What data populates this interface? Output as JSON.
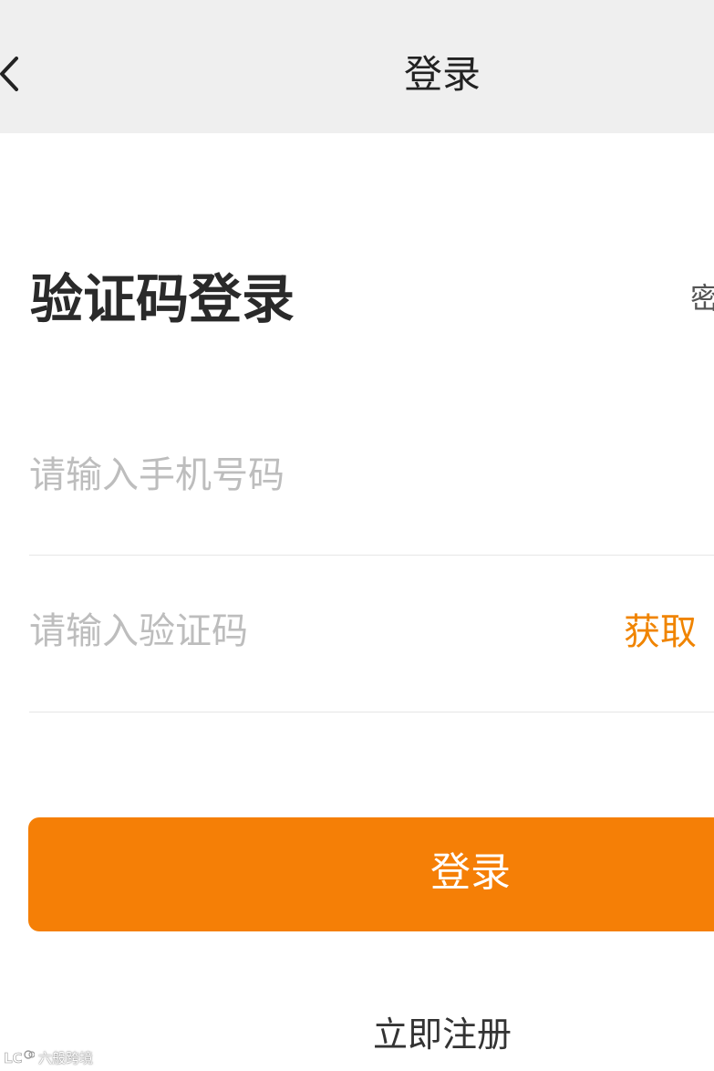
{
  "navbar": {
    "title": "登录",
    "back_icon": "chevron-left-icon",
    "background": "#efefef"
  },
  "form": {
    "heading": "验证码登录",
    "switch_link": "密",
    "phone_placeholder": "请输入手机号码",
    "code_placeholder": "请输入验证码",
    "get_code_label": "获取",
    "submit_label": "登录",
    "register_label": "立即注册"
  },
  "watermark": {
    "text": "六般跨境"
  },
  "colors": {
    "accent": "#f57f06",
    "accent_text": "#f08400",
    "placeholder": "#bdbdbd",
    "heading": "#2a2a2a"
  }
}
